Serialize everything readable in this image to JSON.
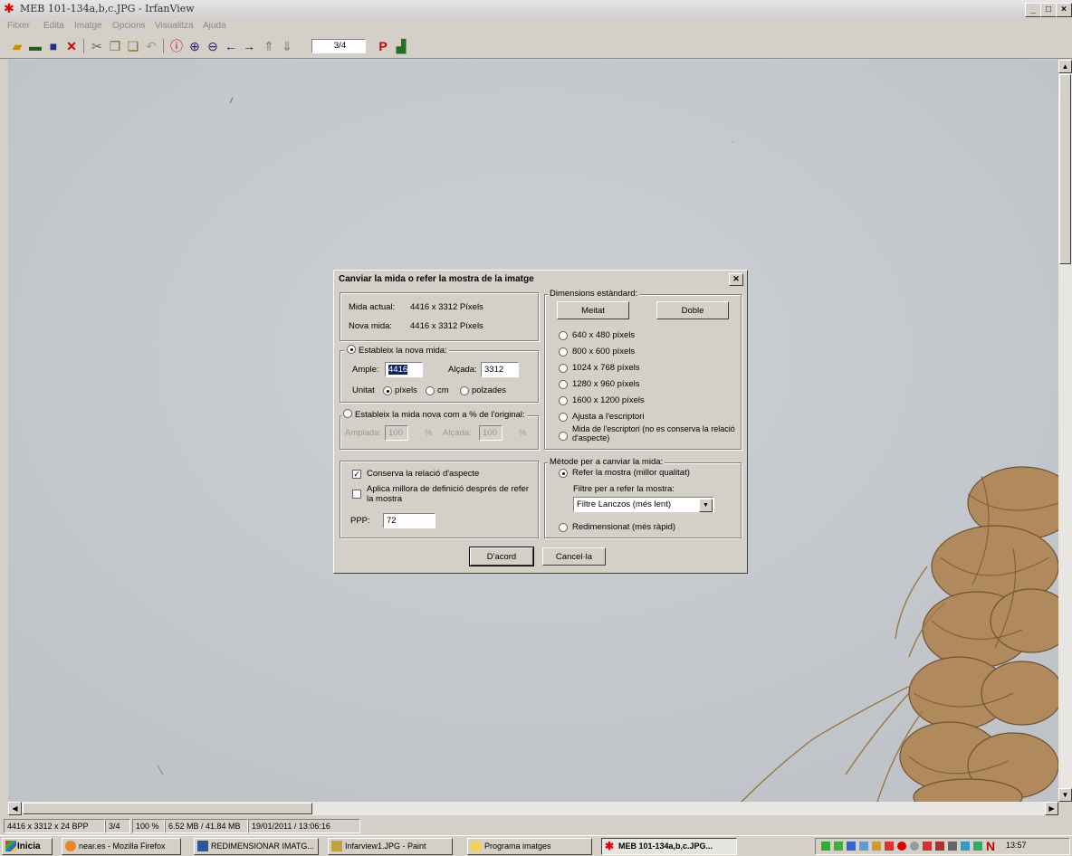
{
  "window": {
    "title": "MEB 101-134a,b,c.JPG - IrfanView",
    "controls": [
      "_",
      "□",
      "×"
    ]
  },
  "menu": [
    "Fitxer",
    "Edita",
    "Imatge",
    "Opcions",
    "Visualitza",
    "Ajuda"
  ],
  "toolbar": {
    "page_field": "3/4"
  },
  "dialog": {
    "title": "Canviar la mida o refer la mostra de la imatge",
    "current_label": "Mida actual:",
    "current_value": "4416  x  3312  Píxels",
    "new_label": "Nova mida:",
    "new_value": "4416  x  3312  Píxels",
    "set_new_size": "Estableix la nova mida:",
    "width_label": "Ample:",
    "width_value": "4416",
    "height_label": "Alçada:",
    "height_value": "3312",
    "unit_label": "Unitat",
    "unit_pixels": "píxels",
    "unit_cm": "cm",
    "unit_inches": "polzades",
    "percent_group": "Estableix la mida nova com a % de l'original:",
    "pct_width_label": "Amplada:",
    "pct_width_value": "100",
    "pct_height_label": "Alçada:",
    "pct_height_value": "100",
    "pct_sign": "%",
    "keep_aspect": "Conserva la relació d'aspecte",
    "sharpen": "Aplica millora de definició després de refer la mostra",
    "ppp_label": "PPP:",
    "ppp_value": "72",
    "std_group": "Dimensions estàndard:",
    "half_button": "Meitat",
    "double_button": "Doble",
    "std_options": [
      "640 x 480 píxels",
      "800 x 600 píxels",
      "1024 x 768 píxels",
      "1280 x 960 píxels",
      "1600 x 1200 píxels",
      "Ajusta a l'escriptori"
    ],
    "desktop_no_aspect": "Mida de l'escriptori (no es conserva la relació d'aspecte)",
    "method_group": "Mètode per a canviar la mida:",
    "resample": "Refer la mostra (millor qualitat)",
    "filter_label": "Filtre per a refer la mostra:",
    "filter_value": "Filtre Lanczos (més lent)",
    "resize_fast": "Redimensionat (més ràpid)",
    "ok_button": "D'acord",
    "cancel_button": "Cancel·la"
  },
  "status": [
    "4416 x 3312 x 24 BPP",
    "3/4",
    "100 %",
    "6.52 MB / 41.84 MB",
    "19/01/2011 / 13:06:16"
  ],
  "taskbar": {
    "start": "Inicia",
    "tasks": [
      "near.es - Mozilla Firefox",
      "REDIMENSIONAR IMATG...",
      "Infarview1.JPG - Paint",
      "Programa imatges",
      "MEB 101-134a,b,c.JPG..."
    ],
    "clock": "13:57"
  },
  "colors": {
    "canvas": "#c8ccd0",
    "rope": "#b08a5c",
    "accent": "#cc0000"
  }
}
